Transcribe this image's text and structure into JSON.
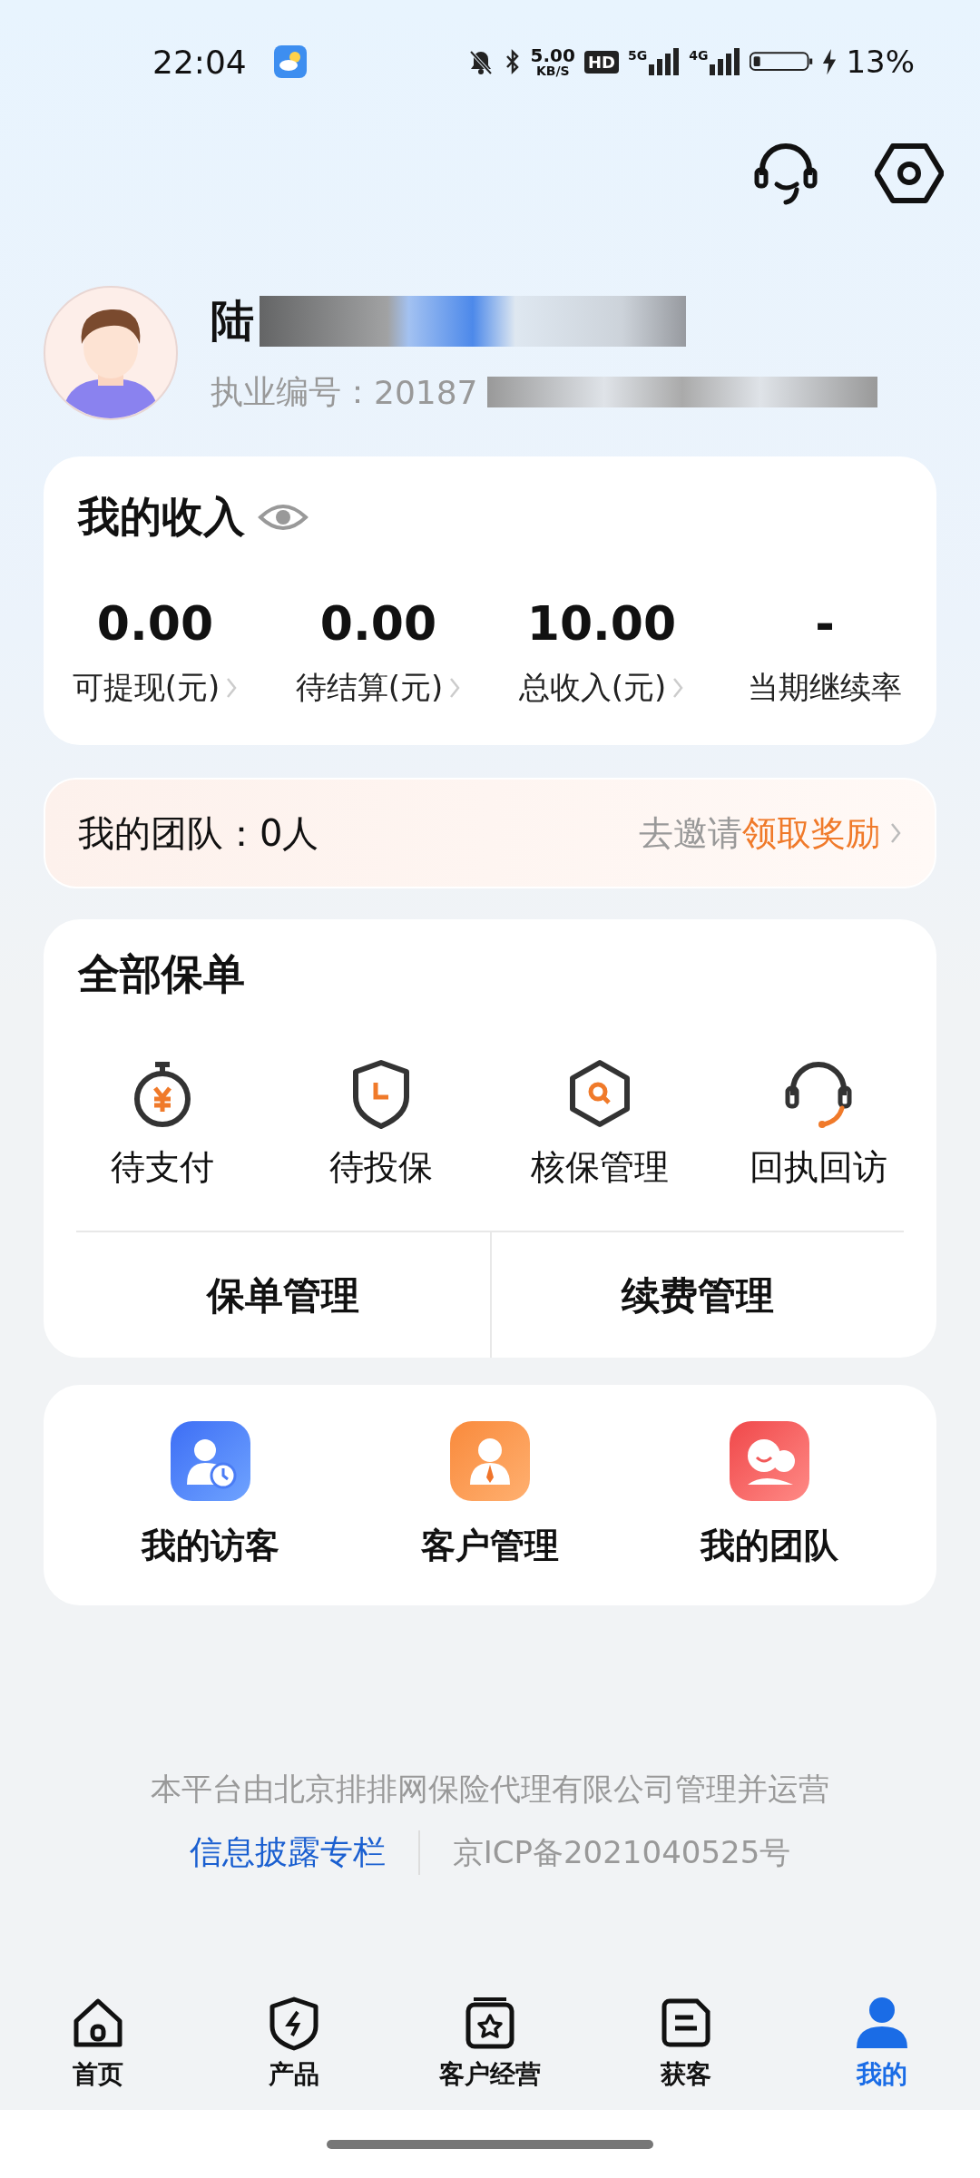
{
  "status_bar": {
    "time": "22:04",
    "speed": "5.00",
    "speed_unit": "KB/S",
    "hd": "HD",
    "network_1": "5G",
    "network_2": "4G",
    "battery": "13%"
  },
  "profile": {
    "name": "陆",
    "license_label": "执业编号：",
    "license_number": "20187"
  },
  "income": {
    "title": "我的收入",
    "items": [
      {
        "value": "0.00",
        "label": "可提现(元)",
        "has_arrow": true
      },
      {
        "value": "0.00",
        "label": "待结算(元)",
        "has_arrow": true
      },
      {
        "value": "10.00",
        "label": "总收入(元)",
        "has_arrow": true
      },
      {
        "value": "-",
        "label": "当期继续率",
        "has_arrow": false
      }
    ]
  },
  "team_banner": {
    "label": "我的团队：0人",
    "invite": "去邀请",
    "reward": "领取奖励"
  },
  "policies": {
    "title": "全部保单",
    "items": [
      {
        "label": "待支付",
        "kind": "stopwatch"
      },
      {
        "label": "待投保",
        "kind": "shield"
      },
      {
        "label": "核保管理",
        "kind": "hexagon"
      },
      {
        "label": "回执回访",
        "kind": "headset"
      }
    ],
    "actions": [
      "保单管理",
      "续费管理"
    ]
  },
  "shortcuts": [
    {
      "label": "我的访客",
      "kind": "visitor"
    },
    {
      "label": "客户管理",
      "kind": "customer"
    },
    {
      "label": "我的团队",
      "kind": "team"
    }
  ],
  "footer": {
    "operator": "本平台由北京排排网保险代理有限公司管理并运营",
    "disclosure_link": "信息披露专栏",
    "icp": "京ICP备2021040525号"
  },
  "bottom_nav": [
    {
      "label": "首页",
      "kind": "home",
      "selected": false
    },
    {
      "label": "产品",
      "kind": "product",
      "selected": false
    },
    {
      "label": "客户经营",
      "kind": "customers",
      "selected": false
    },
    {
      "label": "获客",
      "kind": "leads",
      "selected": false
    },
    {
      "label": "我的",
      "kind": "me",
      "selected": true
    }
  ]
}
